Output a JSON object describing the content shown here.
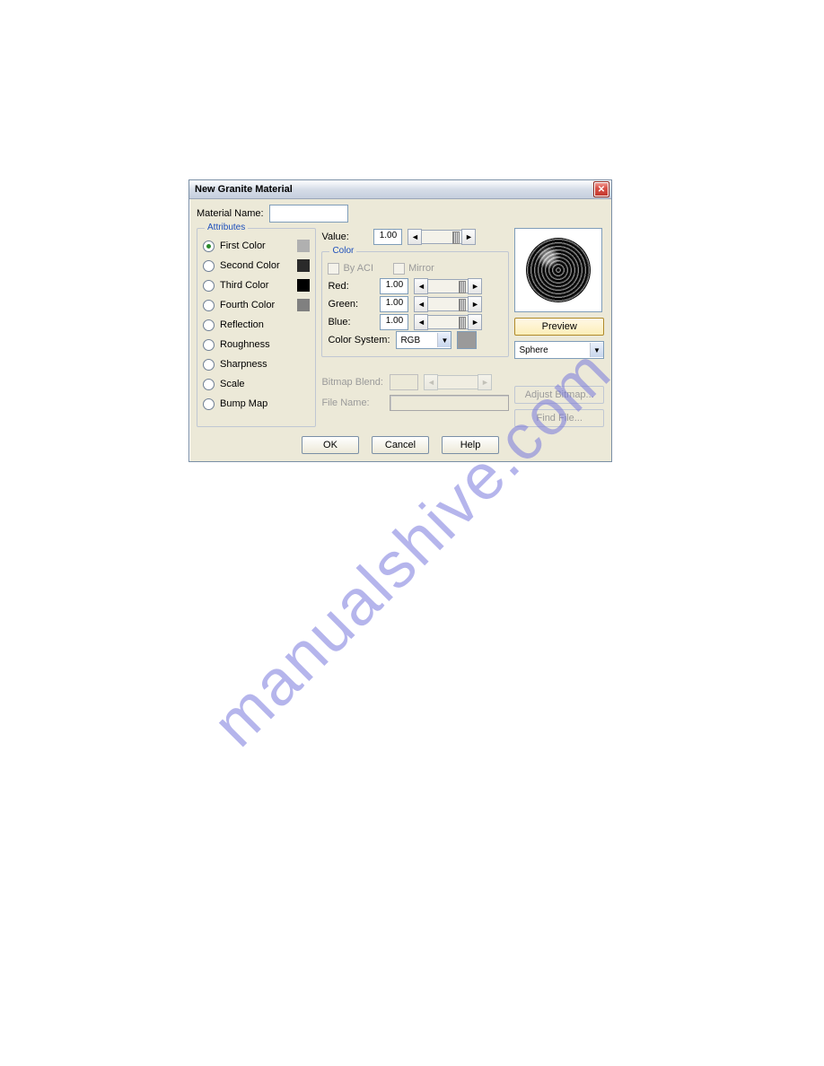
{
  "watermark": "manualshive.com",
  "title": "New Granite Material",
  "material_name_label": "Material Name:",
  "material_name_value": "",
  "groups": {
    "attributes": "Attributes",
    "color": "Color"
  },
  "attributes": [
    {
      "label": "First Color",
      "swatch": "#b0b0b0",
      "checked": true
    },
    {
      "label": "Second Color",
      "swatch": "#2a2a2a",
      "checked": false
    },
    {
      "label": "Third Color",
      "swatch": "#000000",
      "checked": false
    },
    {
      "label": "Fourth Color",
      "swatch": "#808080",
      "checked": false
    },
    {
      "label": "Reflection",
      "swatch": null,
      "checked": false
    },
    {
      "label": "Roughness",
      "swatch": null,
      "checked": false
    },
    {
      "label": "Sharpness",
      "swatch": null,
      "checked": false
    },
    {
      "label": "Scale",
      "swatch": null,
      "checked": false
    },
    {
      "label": "Bump Map",
      "swatch": null,
      "checked": false
    }
  ],
  "value_row": {
    "label": "Value:",
    "value": "1.00"
  },
  "color_box": {
    "by_aci": "By ACI",
    "mirror": "Mirror",
    "red": {
      "label": "Red:",
      "value": "1.00"
    },
    "green": {
      "label": "Green:",
      "value": "1.00"
    },
    "blue": {
      "label": "Blue:",
      "value": "1.00"
    },
    "system_label": "Color System:",
    "system_value": "RGB"
  },
  "bitmap": {
    "blend_label": "Bitmap Blend:",
    "blend_value": "",
    "file_label": "File Name:",
    "adjust_btn": "Adjust Bitmap...",
    "find_btn": "Find File..."
  },
  "right": {
    "preview_btn": "Preview",
    "shape_value": "Sphere"
  },
  "buttons": {
    "ok": "OK",
    "cancel": "Cancel",
    "help": "Help"
  },
  "arrows": {
    "left": "◄",
    "right": "►",
    "down": "▼"
  }
}
